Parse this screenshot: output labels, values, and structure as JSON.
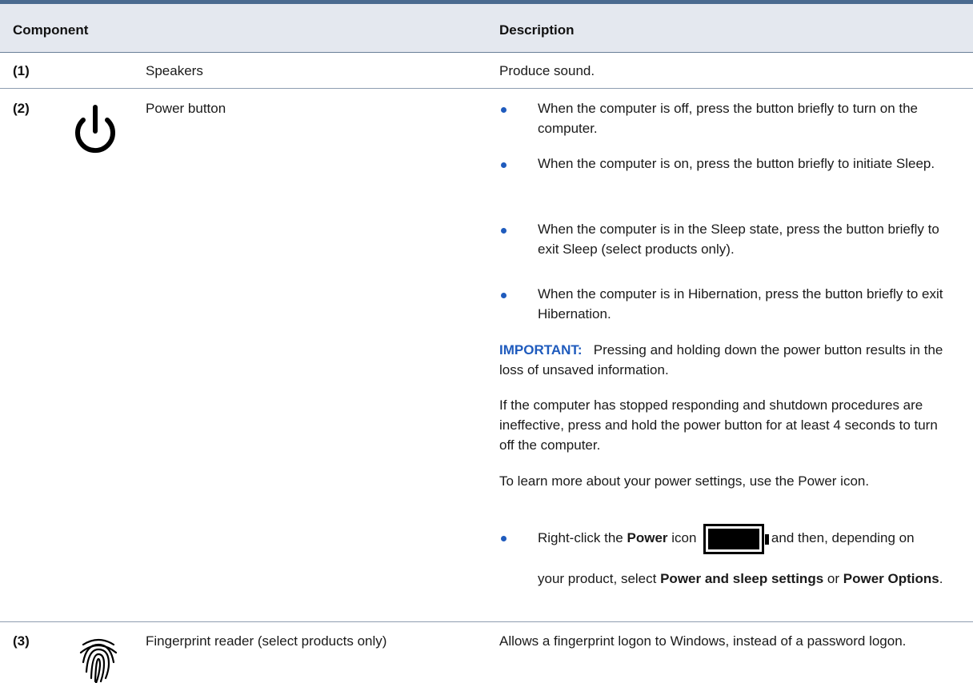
{
  "table": {
    "headers": {
      "component": "Component",
      "description": "Description"
    }
  },
  "rows": {
    "speakers": {
      "num": "(1)",
      "name": "Speakers",
      "desc": "Produce sound."
    },
    "power": {
      "num": "(2)",
      "name": "Power button",
      "icon": "power-icon",
      "bullets": [
        "When the computer is off, press the button briefly to turn on the computer.",
        "When the computer is on, press the button briefly to initiate Sleep.",
        "When the computer is in the Sleep state, press the button briefly to exit Sleep (select products only).",
        "When the computer is in Hibernation, press the button briefly to exit Hibernation."
      ],
      "important_label": "IMPORTANT:",
      "important_text": "Pressing and holding down the power button results in the loss of unsaved information.",
      "stopped_text": "If the computer has stopped responding and shutdown procedures are ineffective, press and hold the power button for at least 4 seconds to turn off the computer.",
      "learn_text": "To learn more about your power settings, use the Power icon.",
      "rc_prefix": "Right-click the",
      "rc_power": "Power",
      "rc_icon": "icon",
      "battery_icon": "battery-icon",
      "rc_suffix": "and then, depending on",
      "product_prefix": "your product, select",
      "power_sleep": "Power and sleep settings",
      "or_word": "or",
      "power_options": "Power Options",
      "period": "."
    },
    "fingerprint": {
      "num": "(3)",
      "name": "Fingerprint reader (select products only)",
      "icon": "fingerprint-icon",
      "desc": "Allows a fingerprint logon to Windows, instead of a password logon."
    }
  },
  "colors": {
    "accent": "#1f5bbd",
    "header_bg": "#e4e8ef",
    "rule": "#4a6a8f"
  }
}
